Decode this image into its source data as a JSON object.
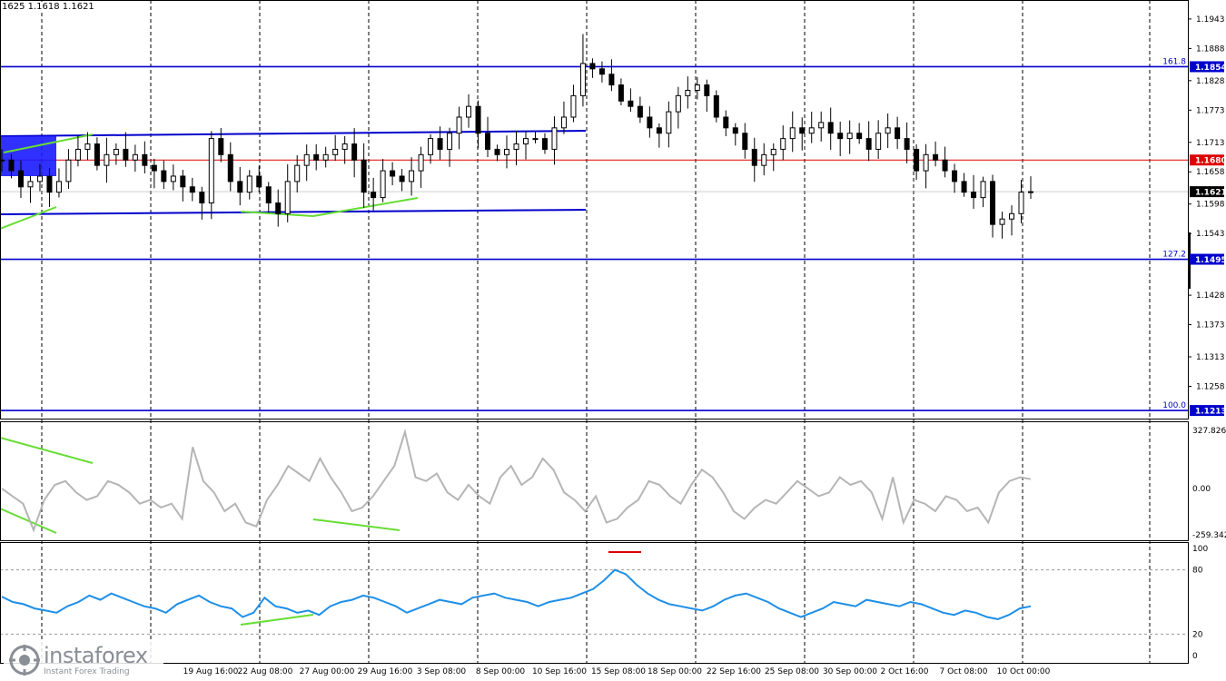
{
  "header": {
    "ohlc": "1625 1.1618 1.1621"
  },
  "price_axis": {
    "ticks": [
      "1.1943",
      "1.1888",
      "1.1828",
      "1.1773",
      "1.1713",
      "1.1658",
      "1.1598",
      "1.1543",
      "1.1428",
      "1.1373",
      "1.1313",
      "1.1258"
    ],
    "levels": [
      {
        "value": 1.1854,
        "label": "1.1854",
        "fib": "161.8",
        "color": "#0000cc"
      },
      {
        "value": 1.168,
        "label": "1.1680",
        "fib": "",
        "color": "#dd0000"
      },
      {
        "value": 1.1621,
        "label": "1.1621",
        "fib": "",
        "color": "#000000"
      },
      {
        "value": 1.1495,
        "label": "1.1495",
        "fib": "127.2",
        "color": "#0000cc"
      },
      {
        "value": 1.1213,
        "label": "1.1213",
        "fib": "100.0",
        "color": "#0000cc"
      }
    ]
  },
  "cci_panel": {
    "max_label": "327.826",
    "zero_label": "0.00",
    "min_label": "-259.3425"
  },
  "rsi_panel": {
    "ticks": [
      "100",
      "80",
      "20",
      "0"
    ]
  },
  "time_axis": {
    "labels": [
      "19 Aug 16:00",
      "22 Aug 08:00",
      "27 Aug 00:00",
      "29 Aug 16:00",
      "3 Sep 08:00",
      "8 Sep 00:00",
      "10 Sep 16:00",
      "15 Sep 08:00",
      "18 Sep 00:00",
      "22 Sep 16:00",
      "25 Sep 08:00",
      "30 Sep 00:00",
      "2 Oct 16:00",
      "7 Oct 08:00",
      "10 Oct 00:00"
    ]
  },
  "watermark": {
    "name": "instaforex",
    "tagline": "Instant Forex Trading"
  },
  "chart_data": [
    {
      "type": "candlestick",
      "title": "",
      "ylim": [
        1.1203,
        1.1975
      ],
      "x_labels": [
        "19 Aug 16:00",
        "22 Aug 08:00",
        "27 Aug 00:00",
        "29 Aug 16:00",
        "3 Sep 08:00",
        "8 Sep 00:00",
        "10 Sep 16:00",
        "15 Sep 08:00",
        "18 Sep 00:00",
        "22 Sep 16:00",
        "25 Sep 08:00",
        "30 Sep 00:00",
        "2 Oct 16:00",
        "7 Oct 08:00",
        "10 Oct 00:00"
      ],
      "close_path": [
        1.168,
        1.166,
        1.163,
        1.164,
        1.165,
        1.162,
        1.164,
        1.168,
        1.17,
        1.171,
        1.167,
        1.169,
        1.17,
        1.168,
        1.169,
        1.167,
        1.166,
        1.164,
        1.165,
        1.163,
        1.162,
        1.16,
        1.172,
        1.169,
        1.164,
        1.162,
        1.165,
        1.163,
        1.16,
        1.158,
        1.164,
        1.167,
        1.169,
        1.168,
        1.169,
        1.17,
        1.171,
        1.168,
        1.162,
        1.161,
        1.166,
        1.165,
        1.164,
        1.166,
        1.169,
        1.172,
        1.17,
        1.173,
        1.176,
        1.178,
        1.173,
        1.17,
        1.169,
        1.17,
        1.171,
        1.172,
        1.172,
        1.17,
        1.174,
        1.176,
        1.18,
        1.186,
        1.185,
        1.184,
        1.182,
        1.179,
        1.178,
        1.176,
        1.174,
        1.173,
        1.177,
        1.18,
        1.181,
        1.182,
        1.18,
        1.176,
        1.174,
        1.173,
        1.17,
        1.167,
        1.169,
        1.17,
        1.172,
        1.174,
        1.173,
        1.174,
        1.175,
        1.173,
        1.172,
        1.173,
        1.172,
        1.17,
        1.173,
        1.174,
        1.172,
        1.17,
        1.166,
        1.169,
        1.168,
        1.166,
        1.164,
        1.162,
        1.161,
        1.164,
        1.156,
        1.157,
        1.158,
        1.162,
        1.1621
      ],
      "levels": [
        {
          "name": "161.8",
          "value": 1.1854
        },
        {
          "name": "",
          "value": 1.168
        },
        {
          "name": "127.2",
          "value": 1.1495
        },
        {
          "name": "100.0",
          "value": 1.1213
        }
      ],
      "last_price": 1.1621
    },
    {
      "type": "line",
      "ylim": [
        -259.3425,
        327.826
      ],
      "y_ticks": [
        "327.826",
        "0.00",
        "-259.3425"
      ],
      "values": [
        0,
        -40,
        -80,
        -220,
        -60,
        20,
        40,
        -20,
        -60,
        -40,
        40,
        20,
        -20,
        -80,
        -60,
        -100,
        -80,
        -160,
        220,
        40,
        -20,
        -120,
        -80,
        -180,
        -200,
        -60,
        20,
        120,
        80,
        40,
        160,
        60,
        -20,
        -120,
        -100,
        -40,
        40,
        120,
        300,
        60,
        40,
        80,
        -20,
        -60,
        20,
        -40,
        -80,
        60,
        120,
        20,
        60,
        160,
        100,
        -20,
        -60,
        -120,
        -40,
        -180,
        -160,
        -100,
        -60,
        40,
        20,
        -40,
        -80,
        20,
        100,
        60,
        -20,
        -120,
        -160,
        -100,
        -60,
        -80,
        -20,
        40,
        0,
        -40,
        -20,
        60,
        20,
        40,
        -20,
        -160,
        60,
        -180,
        -60,
        -80,
        -120,
        -40,
        -60,
        -120,
        -100,
        -180,
        -20,
        40,
        60,
        50
      ]
    },
    {
      "type": "line",
      "ylim": [
        0,
        100
      ],
      "y_ticks": [
        "100",
        "80",
        "20",
        "0"
      ],
      "values": [
        55,
        50,
        48,
        44,
        42,
        40,
        46,
        50,
        56,
        52,
        58,
        54,
        50,
        46,
        44,
        40,
        48,
        52,
        56,
        50,
        46,
        44,
        36,
        40,
        54,
        46,
        44,
        40,
        42,
        38,
        46,
        50,
        52,
        56,
        54,
        50,
        46,
        40,
        44,
        48,
        52,
        50,
        48,
        54,
        56,
        58,
        54,
        52,
        50,
        46,
        50,
        52,
        54,
        58,
        62,
        70,
        80,
        76,
        66,
        58,
        52,
        48,
        46,
        44,
        42,
        46,
        52,
        56,
        58,
        54,
        50,
        44,
        40,
        36,
        40,
        44,
        50,
        48,
        46,
        52,
        50,
        48,
        46,
        50,
        48,
        44,
        40,
        38,
        42,
        40,
        36,
        34,
        38,
        44,
        46
      ],
      "reference_lines": [
        80,
        20
      ]
    }
  ]
}
